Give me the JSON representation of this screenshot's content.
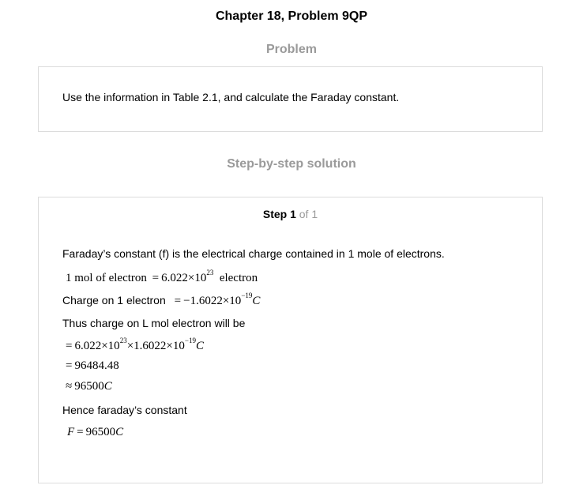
{
  "header": {
    "chapter_title": "Chapter 18, Problem 9QP"
  },
  "problem": {
    "heading": "Problem",
    "text": "Use the information in Table 2.1, and calculate the Faraday constant."
  },
  "solution": {
    "heading": "Step-by-step solution",
    "step": {
      "label": "Step 1",
      "count": "of 1",
      "intro": "Faraday’s constant (f) is the electrical charge contained in 1 mole of electrons.",
      "eq1": {
        "lhs": "1 mol of electron",
        "op": "=",
        "mantissa": "6.022",
        "times": "×10",
        "exp": "23",
        "unit": "electron"
      },
      "charge": {
        "label": "Charge on 1 electron",
        "op": "=",
        "mantissa": "−1.6022",
        "times": "×10",
        "exp": "−19",
        "unit": "C"
      },
      "thus": "Thus charge on L mol electron will be",
      "calc1": {
        "op": "=",
        "a": "6.022",
        "times1": "×10",
        "exp1": "23",
        "b": "×1.6022",
        "times2": "×10",
        "exp2": "−19",
        "unit": "C"
      },
      "calc2": {
        "op": "=",
        "value": "96484.48"
      },
      "calc3": {
        "op": "≈",
        "value": "96500",
        "unit": "C"
      },
      "hence": "Hence faraday’s constant",
      "final": {
        "symbol": "F",
        "op": "=",
        "value": "96500",
        "unit": "C"
      }
    }
  }
}
